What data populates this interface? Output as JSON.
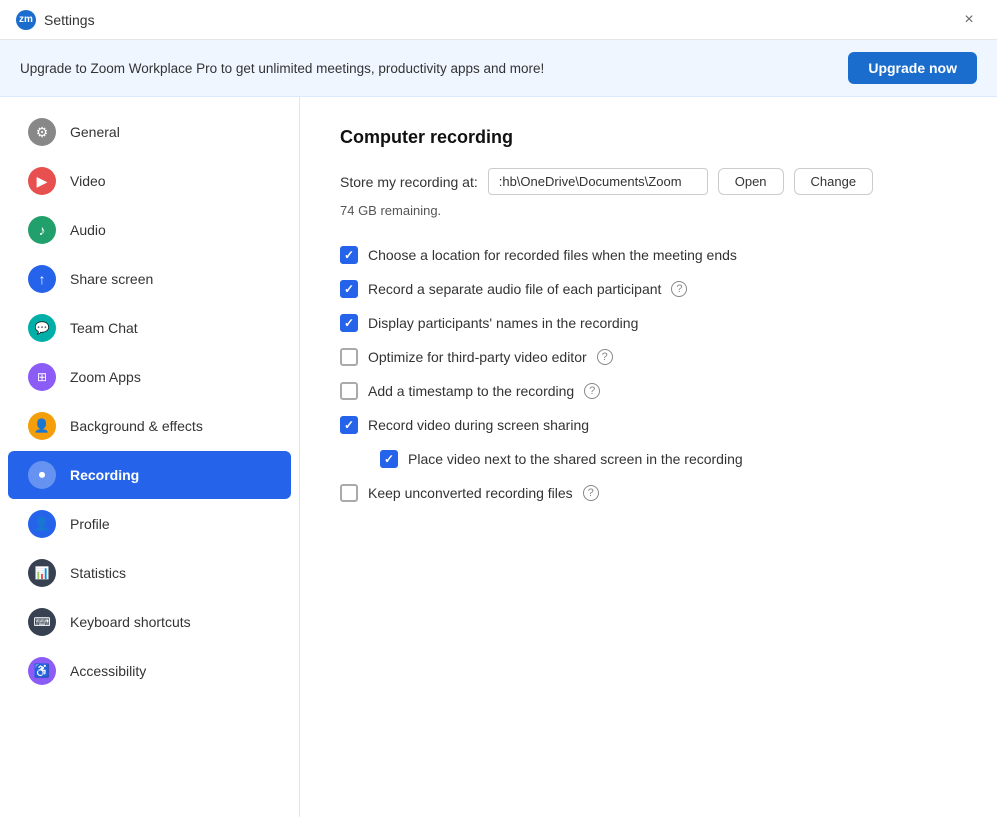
{
  "titleBar": {
    "logo": "zm",
    "title": "Settings",
    "closeLabel": "×"
  },
  "banner": {
    "text": "Upgrade to Zoom Workplace Pro to get unlimited meetings, productivity apps and more!",
    "upgradeButton": "Upgrade now"
  },
  "sidebar": {
    "items": [
      {
        "id": "general",
        "label": "General",
        "iconType": "gear",
        "iconColor": "icon-gray",
        "active": false
      },
      {
        "id": "video",
        "label": "Video",
        "iconType": "video",
        "iconColor": "icon-red",
        "active": false
      },
      {
        "id": "audio",
        "label": "Audio",
        "iconType": "audio",
        "iconColor": "icon-green",
        "active": false
      },
      {
        "id": "share-screen",
        "label": "Share screen",
        "iconType": "share",
        "iconColor": "icon-blue",
        "active": false
      },
      {
        "id": "team-chat",
        "label": "Team Chat",
        "iconType": "chat",
        "iconColor": "icon-teal",
        "active": false
      },
      {
        "id": "zoom-apps",
        "label": "Zoom Apps",
        "iconType": "apps",
        "iconColor": "icon-purple",
        "active": false
      },
      {
        "id": "background-effects",
        "label": "Background & effects",
        "iconType": "background",
        "iconColor": "icon-orange",
        "active": false
      },
      {
        "id": "recording",
        "label": "Recording",
        "iconType": "record",
        "iconColor": "icon-blue",
        "active": true
      },
      {
        "id": "profile",
        "label": "Profile",
        "iconType": "profile",
        "iconColor": "icon-blue",
        "active": false
      },
      {
        "id": "statistics",
        "label": "Statistics",
        "iconType": "stats",
        "iconColor": "icon-dark",
        "active": false
      },
      {
        "id": "keyboard-shortcuts",
        "label": "Keyboard shortcuts",
        "iconType": "keyboard",
        "iconColor": "icon-dark",
        "active": false
      },
      {
        "id": "accessibility",
        "label": "Accessibility",
        "iconType": "accessibility",
        "iconColor": "icon-purple",
        "active": false
      }
    ]
  },
  "content": {
    "sectionTitle": "Computer recording",
    "storeLabel": "Store my recording at:",
    "pathValue": ":hb\\OneDrive\\Documents\\Zoom",
    "openButton": "Open",
    "changeButton": "Change",
    "remainingText": "74 GB remaining.",
    "options": [
      {
        "id": "choose-location",
        "label": "Choose a location for recorded files when the meeting ends",
        "checked": true,
        "help": false,
        "indented": false
      },
      {
        "id": "separate-audio",
        "label": "Record a separate audio file of each participant",
        "checked": true,
        "help": true,
        "indented": false
      },
      {
        "id": "display-names",
        "label": "Display participants' names in the recording",
        "checked": true,
        "help": false,
        "indented": false
      },
      {
        "id": "optimize-editor",
        "label": "Optimize for third-party video editor",
        "checked": false,
        "help": true,
        "indented": false
      },
      {
        "id": "add-timestamp",
        "label": "Add a timestamp to the recording",
        "checked": false,
        "help": true,
        "indented": false
      },
      {
        "id": "record-screen-sharing",
        "label": "Record video during screen sharing",
        "checked": true,
        "help": false,
        "indented": false
      },
      {
        "id": "place-video-next",
        "label": "Place video next to the shared screen in the recording",
        "checked": true,
        "help": false,
        "indented": true
      },
      {
        "id": "keep-unconverted",
        "label": "Keep unconverted recording files",
        "checked": false,
        "help": true,
        "indented": false
      }
    ]
  },
  "icons": {
    "gear": "⚙",
    "video": "🎥",
    "audio": "🎧",
    "share": "↑",
    "chat": "💬",
    "apps": "⊞",
    "background": "👤",
    "record": "⏺",
    "profile": "👤",
    "stats": "📊",
    "keyboard": "⌨",
    "accessibility": "♿"
  }
}
